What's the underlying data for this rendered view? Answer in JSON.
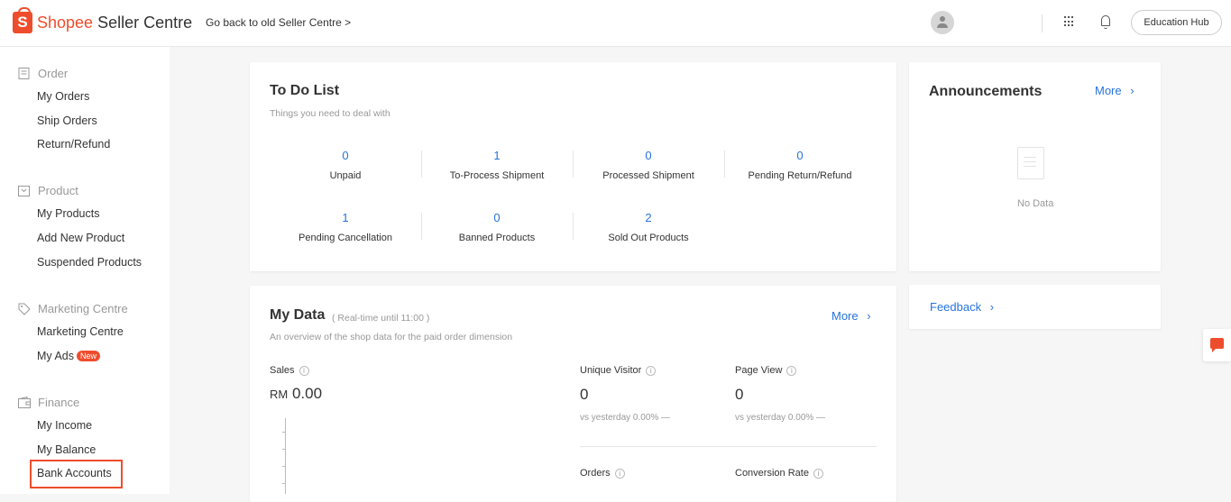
{
  "header": {
    "brand": "Shopee",
    "product": "Seller Centre",
    "back_link": "Go back to old Seller Centre >",
    "education_hub": "Education Hub"
  },
  "sidebar": {
    "groups": [
      {
        "title": "Order",
        "icon": "order-icon",
        "items": [
          "My Orders",
          "Ship Orders",
          "Return/Refund"
        ]
      },
      {
        "title": "Product",
        "icon": "product-icon",
        "items": [
          "My Products",
          "Add New Product",
          "Suspended Products"
        ]
      },
      {
        "title": "Marketing Centre",
        "icon": "marketing-tag-icon",
        "items": [
          "Marketing Centre",
          "My Ads"
        ]
      },
      {
        "title": "Finance",
        "icon": "wallet-icon",
        "items": [
          "My Income",
          "My Balance",
          "Bank Accounts"
        ]
      }
    ],
    "new_badge": "New"
  },
  "todo": {
    "title": "To Do List",
    "subtitle": "Things you need to deal with",
    "items": [
      {
        "value": "0",
        "label": "Unpaid"
      },
      {
        "value": "1",
        "label": "To-Process Shipment"
      },
      {
        "value": "0",
        "label": "Processed Shipment"
      },
      {
        "value": "0",
        "label": "Pending Return/Refund"
      },
      {
        "value": "1",
        "label": "Pending Cancellation"
      },
      {
        "value": "0",
        "label": "Banned Products"
      },
      {
        "value": "2",
        "label": "Sold Out Products"
      }
    ]
  },
  "announcements": {
    "title": "Announcements",
    "more": "More",
    "empty": "No Data"
  },
  "feedback": {
    "label": "Feedback"
  },
  "mydata": {
    "title": "My Data",
    "realtime": "( Real-time until 11:00 )",
    "subtitle": "An overview of the shop data for the paid order dimension",
    "more": "More",
    "sales_label": "Sales",
    "sales_currency": "RM",
    "sales_value": "0.00",
    "unique_visitor_label": "Unique Visitor",
    "unique_visitor_value": "0",
    "unique_visitor_cmp": "vs yesterday 0.00% —",
    "page_view_label": "Page View",
    "page_view_value": "0",
    "page_view_cmp": "vs yesterday 0.00% —",
    "orders_label": "Orders",
    "conversion_label": "Conversion Rate"
  },
  "colors": {
    "brand": "#ee4d2d",
    "link": "#2673dd"
  }
}
